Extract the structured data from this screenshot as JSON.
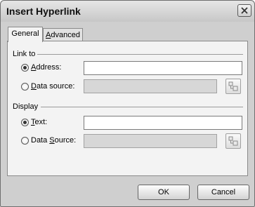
{
  "dialog": {
    "title": "Insert Hyperlink",
    "close_icon": "close-x-icon"
  },
  "tabs": [
    {
      "label": "General",
      "active": true
    },
    {
      "label_pre": "",
      "label_u": "A",
      "label_post": "dvanced",
      "active": false
    }
  ],
  "link_to": {
    "heading": "Link to",
    "address": {
      "label_pre": "",
      "label_u": "A",
      "label_post": "ddress:",
      "selected": true,
      "value": ""
    },
    "data_source": {
      "label_pre": "",
      "label_u": "D",
      "label_post": "ata source:",
      "selected": false,
      "value": "",
      "enabled": false,
      "browse_icon": "data-source-picker-icon"
    }
  },
  "display": {
    "heading": "Display",
    "text": {
      "label_pre": "",
      "label_u": "T",
      "label_post": "ext:",
      "selected": true,
      "value": ""
    },
    "data_source": {
      "label_pre": "Data ",
      "label_u": "S",
      "label_post": "ource:",
      "selected": false,
      "value": "",
      "enabled": false,
      "browse_icon": "data-source-picker-icon"
    }
  },
  "buttons": {
    "ok": "OK",
    "cancel": "Cancel"
  },
  "colors": {
    "dialog_bg": "#cfcfcf",
    "panel_bg": "#f3f3f3",
    "disabled_field": "#d7d7d7"
  }
}
